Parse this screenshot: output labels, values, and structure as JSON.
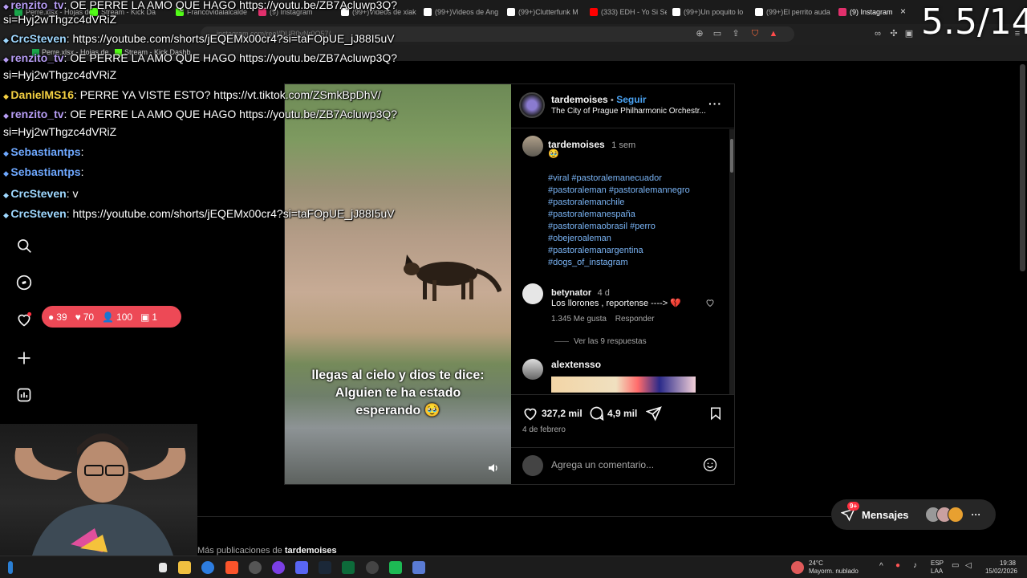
{
  "browser": {
    "tabs": [
      {
        "label": "Perre.xlsx - Hojas de",
        "color": "#1aa64b"
      },
      {
        "label": "Stream - Kick Da",
        "color": "#53fc18"
      },
      {
        "label": "Francovidalalcalde",
        "color": "#53fc18"
      },
      {
        "label": "(9) Instagram",
        "color": "#e1306c"
      },
      {
        "label": "(99+)Videos de xiak",
        "color": "#ffffff"
      },
      {
        "label": "(99+)Videos de Ang",
        "color": "#ffffff"
      },
      {
        "label": "(99+)Clutterfunk M",
        "color": "#ffffff"
      },
      {
        "label": "(333) EDH - Yo Si Se",
        "color": "#ff0000"
      },
      {
        "label": "(99+)Un poquito lo",
        "color": "#ffffff"
      },
      {
        "label": "(99+)El perrito auda",
        "color": "#ffffff"
      },
      {
        "label": "(9) Instagram",
        "color": "#e1306c"
      }
    ],
    "url": "instagram.com/reel/DUR0vNr0Q57/",
    "bookmarks": [
      "Perre.xlsx - Hojas de",
      "Stream - Kick Dashb"
    ]
  },
  "chat": [
    {
      "user": "renzito_tv",
      "text": ": OE PERRE LA AMO QUE HAGO https://youtu.be/ZB7Acluwp3Q?",
      "color": "#b79df5"
    },
    {
      "user": "",
      "text": "si=Hyj2wThgzc4dVRiZ",
      "color": "#ffffff"
    },
    {
      "user": "CrcSteven",
      "text": ": https://youtube.com/shorts/jEQEMx00cr4?si=taFOpUE_jJ88I5uV",
      "color": "#9fd8ff"
    },
    {
      "user": "renzito_tv",
      "text": ": OE PERRE LA AMO QUE HAGO https://youtu.be/ZB7Acluwp3Q?",
      "color": "#b79df5"
    },
    {
      "user": "",
      "text": "si=Hyj2wThgzc4dVRiZ",
      "color": "#ffffff"
    },
    {
      "user": "DanielMS16",
      "text": ": PERRE YA VISTE ESTO? https://vt.tiktok.com/ZSmkBpDhV/",
      "color": "#f5d142"
    },
    {
      "user": "renzito_tv",
      "text": ": OE PERRE LA AMO QUE HAGO https://youtu.be/ZB7Acluwp3Q?",
      "color": "#b79df5"
    },
    {
      "user": "",
      "text": "si=Hyj2wThgzc4dVRiZ",
      "color": "#ffffff"
    },
    {
      "user": "Sebastiantps",
      "text": ":",
      "color": "#6ea8ff"
    },
    {
      "user": "Sebastiantps",
      "text": ":",
      "color": "#6ea8ff"
    },
    {
      "user": "CrcSteven",
      "text": ": v",
      "color": "#9fd8ff"
    },
    {
      "user": "CrcSteven",
      "text": ": https://youtube.com/shorts/jEQEMx00cr4?si=taFOpUE_jJ88I5uV",
      "color": "#9fd8ff"
    }
  ],
  "overlay": {
    "counter": "5.5/14",
    "stats": {
      "comments": "39",
      "likes": "70",
      "viewers": "100",
      "subs": "1"
    }
  },
  "post": {
    "author": "tardemoises",
    "follow": "Seguir",
    "separator": "•",
    "audio": "The City of Prague Philharmonic Orchestr...",
    "caption_author": "tardemoises",
    "caption_time": "1 sem",
    "caption_emoji": "🥹",
    "hashtags": [
      "#viral #pastoralemanecuador",
      "#pastoraleman #pastoralemannegro",
      "#pastoralemanchile",
      "#pastoralemanespaña",
      "#pastoralemaobrasil #perro",
      "#obejeroaleman",
      "#pastoralemanargentina",
      "#dogs_of_instagram"
    ],
    "video_caption": [
      "llegas al cielo y dios te dice:",
      "Alguien te ha estado",
      "esperando 🥹"
    ],
    "comment1": {
      "user": "betynator",
      "time": "4 d",
      "text": "Los llorones , reportense ---->",
      "emoji": "💔",
      "likes": "1.345 Me gusta",
      "reply": "Responder",
      "view_replies": "Ver las 9 respuestas"
    },
    "comment2": {
      "user": "alextensso"
    },
    "likes_count": "327,2 mil",
    "comments_count": "4,9 mil",
    "date": "4 de febrero",
    "add_comment_placeholder": "Agrega un comentario..."
  },
  "messages": {
    "label": "Mensajes",
    "badge": "9+"
  },
  "notifications_badge": "9+",
  "more_posts": {
    "prefix": "Más publicaciones de ",
    "user": "tardemoises"
  },
  "taskbar": {
    "weather_temp": "24°C",
    "weather_desc": "Mayorm. nublado",
    "lang_top": "ESP",
    "lang_bottom": "LAA",
    "time": "19:38",
    "date": "15/02/2026"
  }
}
